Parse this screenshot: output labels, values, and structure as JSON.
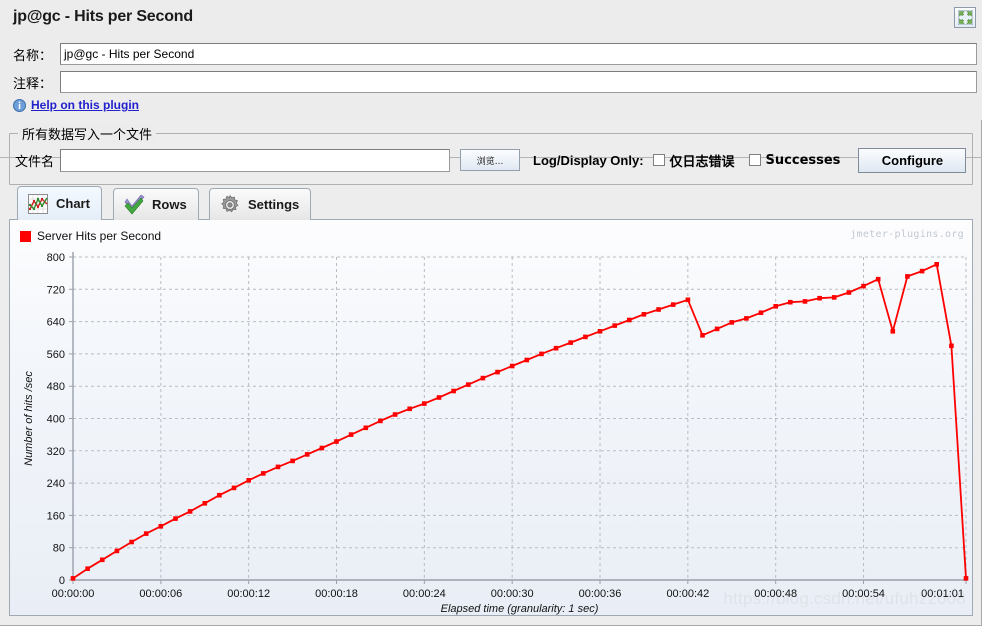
{
  "window": {
    "title": "jp@gc - Hits per Second",
    "expand_icon": "expand-arrows-icon"
  },
  "form": {
    "name_label": "名称：",
    "name_value": "jp@gc - Hits per Second",
    "comment_label": "注释：",
    "comment_value": "",
    "help_link": "Help on this plugin",
    "info_icon": "info-icon"
  },
  "file_group": {
    "title": "所有数据写入一个文件",
    "filename_label": "文件名",
    "filename_value": "",
    "browse_button": "浏览...",
    "log_display_label": "Log/Display Only:",
    "checkbox_errors": "仅日志错误",
    "checkbox_errors_checked": false,
    "checkbox_successes": "Successes",
    "checkbox_successes_checked": false,
    "configure_button": "Configure"
  },
  "tabs": [
    {
      "label": "Chart",
      "icon": "line-chart-icon",
      "active": true
    },
    {
      "label": "Rows",
      "icon": "green-check-icon",
      "active": false
    },
    {
      "label": "Settings",
      "icon": "gear-icon",
      "active": false
    }
  ],
  "chart_panel": {
    "legend_label": "Server Hits per Second",
    "legend_color": "#ff0000",
    "watermark_plugins": "jmeter-plugins.org",
    "watermark_blog": "https://blog.csdn.net/ufuhz2008"
  },
  "chart_data": {
    "type": "line",
    "title": "",
    "xlabel": "Elapsed time (granularity: 1 sec)",
    "ylabel": "Number of hits /sec",
    "series": [
      {
        "name": "Server Hits per Second",
        "color": "#ff0000",
        "x": [
          0,
          1,
          2,
          3,
          4,
          5,
          6,
          7,
          8,
          9,
          10,
          11,
          12,
          13,
          14,
          15,
          16,
          17,
          18,
          19,
          20,
          21,
          22,
          23,
          24,
          25,
          26,
          27,
          28,
          29,
          30,
          31,
          32,
          33,
          34,
          35,
          36,
          37,
          38,
          39,
          40,
          41,
          42,
          43,
          44,
          45,
          46,
          47,
          48,
          49,
          50,
          51,
          52,
          53,
          54,
          55,
          56,
          57,
          58,
          59,
          60,
          61
        ],
        "values": [
          4,
          28,
          50,
          72,
          94,
          115,
          133,
          152,
          170,
          190,
          210,
          228,
          247,
          264,
          280,
          295,
          311,
          327,
          343,
          360,
          377,
          394,
          410,
          424,
          437,
          452,
          468,
          484,
          500,
          515,
          530,
          545,
          560,
          574,
          588,
          602,
          616,
          630,
          644,
          658,
          670,
          682,
          694,
          606,
          622,
          638,
          648,
          662,
          678,
          688,
          690,
          698,
          700,
          712,
          728,
          745,
          616,
          752,
          765,
          782,
          580,
          4
        ]
      }
    ],
    "x_ticks": [
      "00:00:00",
      "00:00:06",
      "00:00:12",
      "00:00:18",
      "00:00:24",
      "00:00:30",
      "00:00:36",
      "00:00:42",
      "00:00:48",
      "00:00:54",
      "00:01:01"
    ],
    "x_tick_values": [
      0,
      6,
      12,
      18,
      24,
      30,
      36,
      42,
      48,
      54,
      61
    ],
    "y_ticks": [
      0,
      80,
      160,
      240,
      320,
      400,
      480,
      560,
      640,
      720,
      800
    ],
    "xlim": [
      0,
      61
    ],
    "ylim": [
      0,
      800
    ],
    "grid": true,
    "legend_position": "top-left",
    "marker": "square"
  }
}
